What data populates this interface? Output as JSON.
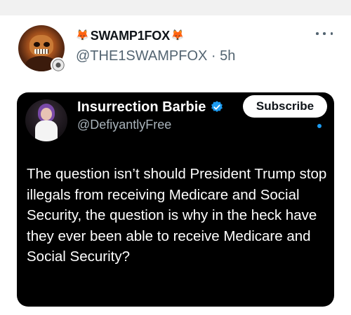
{
  "post": {
    "author_name": "SWAMP1FOX",
    "author_emoji": "🦊",
    "handle_time": "@THE1SWAMPFOX · 5h",
    "icons": [
      "avatar",
      "fox-emoji",
      "badge-icon",
      "more-icon"
    ]
  },
  "quoted": {
    "name": "Insurrection Barbie",
    "handle": "@DefiyantlyFree",
    "subscribe_label": "Subscribe",
    "text": "The question isn’t should President Trump stop illegals from receiving Medicare and Social Security, the question is why in the heck have they ever been able to receive Medicare and Social Security?",
    "icons": [
      "verified-icon",
      "unread-dot"
    ]
  },
  "colors": {
    "verified": "#1d9bf0",
    "card_bg": "#000000",
    "muted": "#536471"
  }
}
